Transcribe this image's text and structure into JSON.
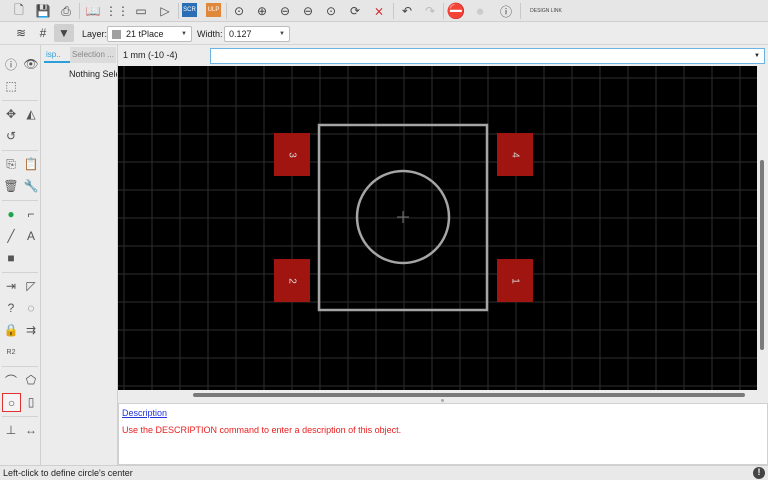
{
  "toolbar": {
    "icons": [
      "new-file-icon",
      "save-icon",
      "print-icon",
      "library-icon",
      "board-icon",
      "schematic-icon",
      "symbol-icon",
      "script-icon",
      "ulp-icon",
      "zoom-fit-icon",
      "zoom-in-icon",
      "zoom-out-icon",
      "zoom-select-icon",
      "zoom-area-icon",
      "redraw-icon",
      "ratsnest-icon",
      "undo-icon",
      "redo-icon",
      "stop-icon",
      "go-icon",
      "help-icon",
      "design-link-icon"
    ],
    "scr_label": "SCR",
    "ulp_label": "ULP",
    "design_link_label": "DESIGN LINK"
  },
  "params": {
    "layer_label": "Layer:",
    "layer_value": "21 tPlace",
    "layer_color": "#a0a0a0",
    "width_label": "Width:",
    "width_value": "0.127"
  },
  "coord": {
    "readout": "1 mm (-10 -4)",
    "command_value": ""
  },
  "panel": {
    "tabs": [
      {
        "label": "isp.."
      },
      {
        "label": "Selection ..."
      }
    ],
    "content": "Nothing Sele"
  },
  "pads": [
    {
      "name": "3"
    },
    {
      "name": "4"
    },
    {
      "name": "2"
    },
    {
      "name": "1"
    }
  ],
  "colors": {
    "pad": "#a0150f",
    "silk": "#a5a5a5",
    "grid": "#2e2e2e",
    "accent": "#2a9fd8"
  },
  "description": {
    "title": "Description",
    "text": "Use the DESCRIPTION command to enter a description of this object."
  },
  "status": {
    "text": "Left-click to define circle's center"
  },
  "tools": [
    "info",
    "show",
    "group",
    "move",
    "mirror",
    "rotate",
    "copy",
    "paste",
    "delete",
    "change",
    "via",
    "route",
    "line",
    "text",
    "smd",
    "pinswap",
    "miter",
    "split",
    "optimize",
    "lock",
    "ripup",
    "name-value",
    "arc",
    "polygon",
    "circle",
    "rect",
    "mark",
    "dimension"
  ],
  "active_tool": "circle"
}
